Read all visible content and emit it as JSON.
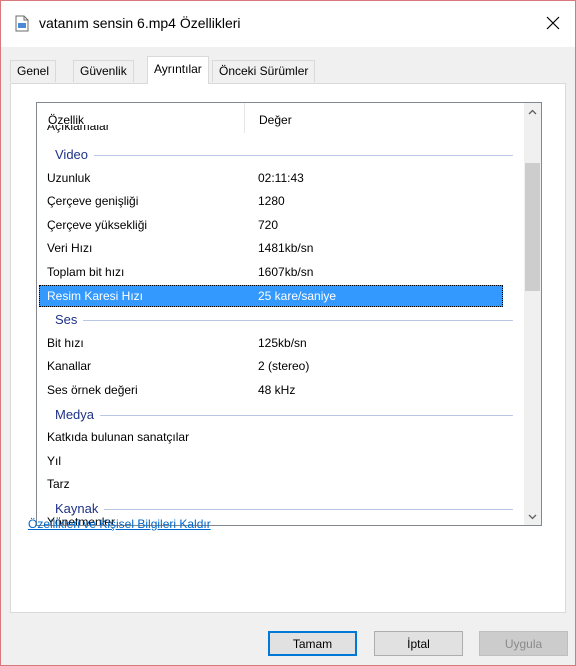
{
  "window": {
    "title": "vatanım sensin 6.mp4 Özellikleri",
    "file_icon": "video-file-icon",
    "close_icon": "close-icon"
  },
  "tabs": [
    {
      "label": "Genel",
      "active": false
    },
    {
      "label": "Güvenlik",
      "active": false
    },
    {
      "label": "Ayrıntılar",
      "active": true
    },
    {
      "label": "Önceki Sürümler",
      "active": false
    }
  ],
  "list": {
    "header": {
      "property": "Özellik",
      "value": "Değer"
    },
    "clipped_top": "Açıklamalar",
    "clipped_bottom": "Yönetmenler",
    "groups": [
      {
        "name": "Video",
        "rows": [
          {
            "property": "Uzunluk",
            "value": "02:11:43"
          },
          {
            "property": "Çerçeve genişliği",
            "value": "1280"
          },
          {
            "property": "Çerçeve yüksekliği",
            "value": "720"
          },
          {
            "property": "Veri Hızı",
            "value": "1481kb/sn"
          },
          {
            "property": "Toplam bit hızı",
            "value": "1607kb/sn"
          },
          {
            "property": "Resim Karesi Hızı",
            "value": "25 kare/saniye",
            "selected": true
          }
        ]
      },
      {
        "name": "Ses",
        "rows": [
          {
            "property": "Bit hızı",
            "value": "125kb/sn"
          },
          {
            "property": "Kanallar",
            "value": "2 (stereo)"
          },
          {
            "property": "Ses örnek değeri",
            "value": "48 kHz"
          }
        ]
      },
      {
        "name": "Medya",
        "rows": [
          {
            "property": "Katkıda bulunan sanatçılar",
            "value": ""
          },
          {
            "property": "Yıl",
            "value": ""
          },
          {
            "property": "Tarz",
            "value": ""
          }
        ]
      },
      {
        "name": "Kaynak",
        "rows": []
      }
    ]
  },
  "remove_link": "Özellikleri ve Kişisel Bilgileri Kaldır",
  "buttons": {
    "ok": "Tamam",
    "cancel": "İptal",
    "apply": "Uygula"
  },
  "colors": {
    "selection": "#3399ff",
    "group_label": "#1e3287",
    "link": "#0066cc",
    "window_border": "#d8787a"
  }
}
